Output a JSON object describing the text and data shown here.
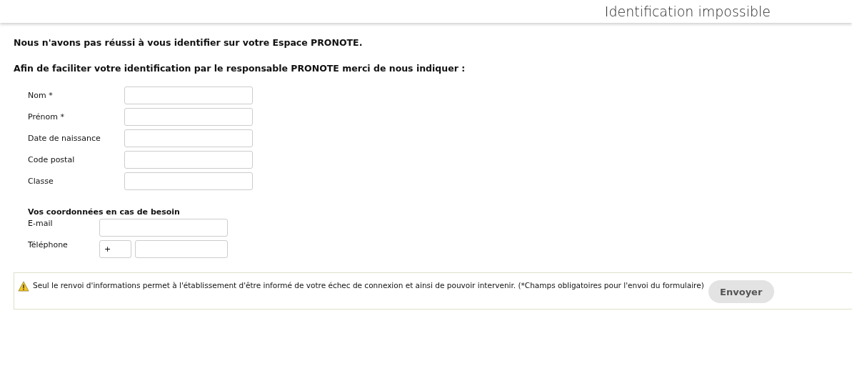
{
  "header": {
    "title": "Identification impossible"
  },
  "intro": "Nous n'avons pas réussi à vous identifier sur votre Espace PRONOTE.",
  "request": "Afin de faciliter votre identification par le responsable PRONOTE merci de nous indiquer :",
  "identity_fields": [
    {
      "label": "Nom *"
    },
    {
      "label": "Prénom *"
    },
    {
      "label": "Date de naissance"
    },
    {
      "label": "Code postal"
    },
    {
      "label": "Classe"
    }
  ],
  "contact": {
    "heading": "Vos coordonnées en cas de besoin",
    "fields": [
      {
        "label": "E-mail",
        "kind": "single"
      },
      {
        "label": "Téléphone",
        "kind": "phone",
        "prefix": "+"
      }
    ]
  },
  "notice": {
    "text": "Seul le renvoi d'informations permet à l'établissement d'être informé de votre échec de connexion et ainsi de pouvoir intervenir. (*Champs obligatoires pour l'envoi du formulaire)",
    "button": "Envoyer"
  }
}
